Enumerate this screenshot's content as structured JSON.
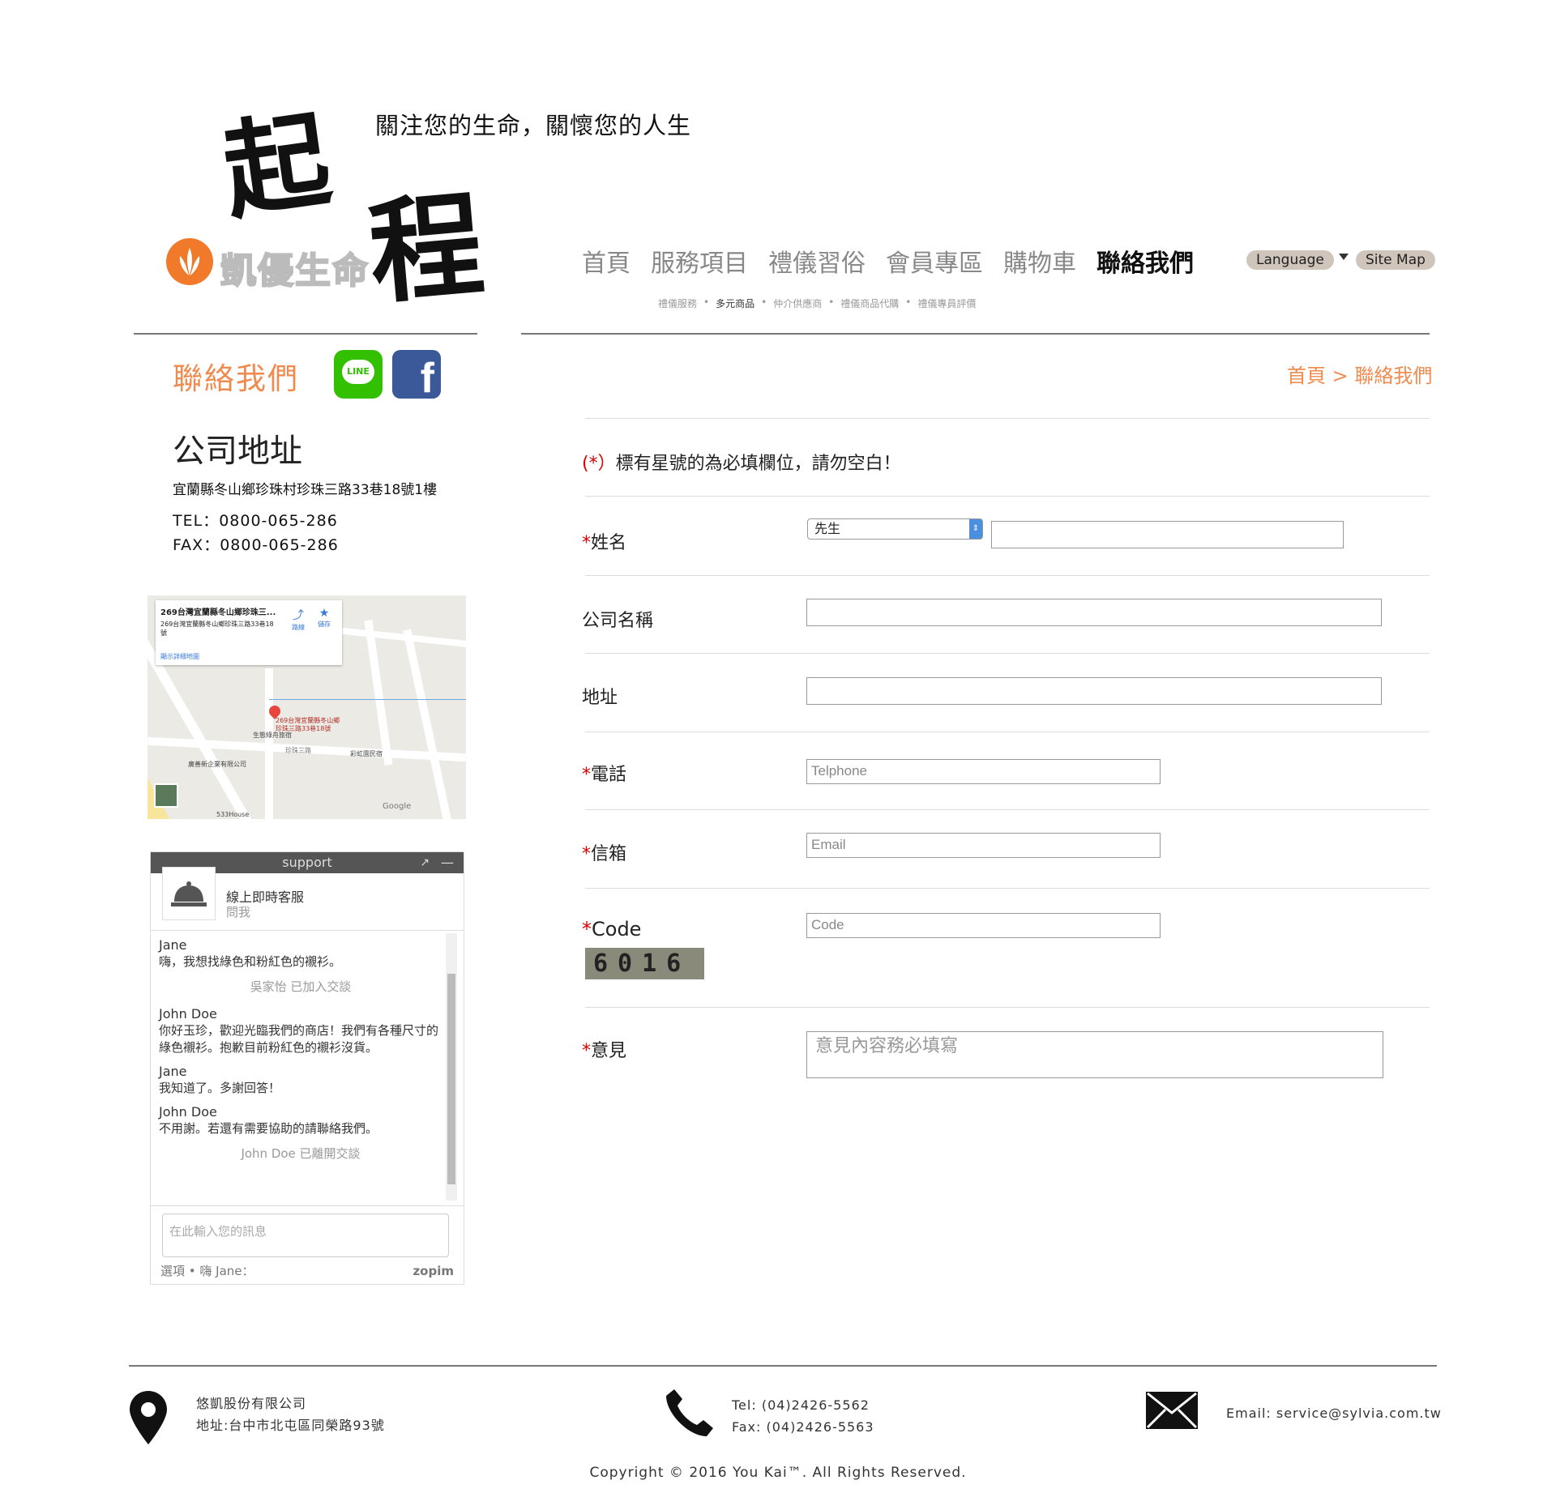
{
  "header": {
    "logo_brush": [
      "起",
      "程"
    ],
    "tagline": "關注您的生命，關懷您的人生",
    "brand": "凱優生命",
    "nav": [
      "首頁",
      "服務項目",
      "禮儀習俗",
      "會員專區",
      "購物車",
      "聯絡我們"
    ],
    "active_nav": "聯絡我們",
    "language_label": "Language",
    "sitemap_label": "Site Map",
    "subnav": [
      "禮儀服務",
      "多元商品",
      "仲介供應商",
      "禮儀商品代購",
      "禮儀專員評價"
    ]
  },
  "sidebar": {
    "title": "聯絡我們",
    "line_label": "LINE",
    "fb_label": "f",
    "address_heading": "公司地址",
    "address": "宜蘭縣冬山鄉珍珠村珍珠三路33巷18號1樓",
    "tel": "TEL：0800-065-286",
    "fax": "FAX：0800-065-286"
  },
  "map": {
    "card_title": "269台灣宜蘭縣冬山鄉珍珠三...",
    "card_address": "269台灣宜蘭縣冬山鄉珍珠三路33巷18號",
    "card_link": "顯示詳細地圖",
    "directions": "路線",
    "save": "儲存",
    "pin_label": "269台灣宜蘭縣冬山鄉珍珠三路33巷18號",
    "places": [
      "生態綠舟旅宿",
      "珍珠三路",
      "彩虹園民宿",
      "廣善新企業有限公司",
      "533House"
    ],
    "google": "Google"
  },
  "chat": {
    "header": "support",
    "agent_title": "線上即時客服",
    "agent_sub": "問我",
    "messages": [
      {
        "who": "Jane",
        "text": "嗨，我想找綠色和粉紅色的襯衫。"
      },
      {
        "sys": "吳家怡 已加入交談"
      },
      {
        "who": "John Doe",
        "text": "你好玉珍，歡迎光臨我們的商店！我們有各種尺寸的綠色襯衫。抱歉目前粉紅色的襯衫沒貨。"
      },
      {
        "who": "Jane",
        "text": "我知道了。多謝回答！"
      },
      {
        "who": "John Doe",
        "text": "不用謝。若還有需要協助的請聯絡我們。"
      },
      {
        "sys": "John Doe 已離開交談"
      }
    ],
    "input_placeholder": "在此輸入您的訊息",
    "footer_left": "選項 • 嗨 Jane：",
    "footer_brand": "zopim"
  },
  "form": {
    "breadcrumb": "首頁 > 聯絡我們",
    "notice_prefix": "(*）",
    "notice": "標有星號的為必填欄位，請勿空白！",
    "name_label": "姓名",
    "title_select": "先生",
    "company_label": "公司名稱",
    "address_label": "地址",
    "phone_label": "電話",
    "phone_placeholder": "Telphone",
    "email_label": "信箱",
    "email_placeholder": "Email",
    "code_label": "Code",
    "code_placeholder": "Code",
    "captcha": "6016",
    "comment_label": "意見",
    "comment_placeholder": "意見內容務必填寫"
  },
  "footer": {
    "company": "悠凱股份有限公司",
    "address": "地址:台中市北屯區同榮路93號",
    "tel": "Tel: (04)2426-5562",
    "fax": "Fax: (04)2426-5563",
    "email": "Email: service@sylvia.com.tw",
    "copyright": "Copyright © 2016 You Kai™. All Rights Reserved."
  }
}
